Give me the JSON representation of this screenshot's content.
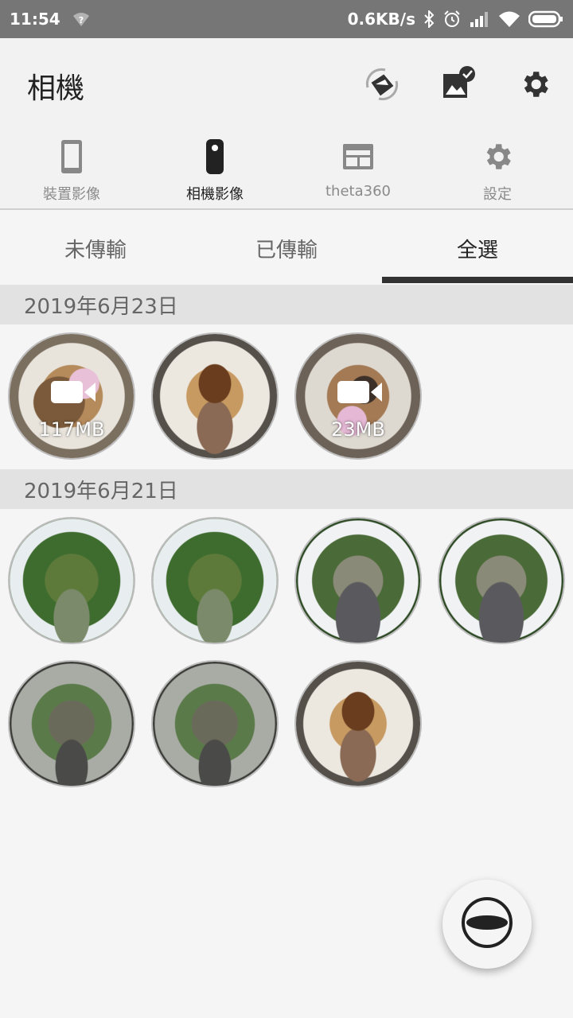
{
  "status": {
    "time": "11:54",
    "speed": "0.6KB/s"
  },
  "appbar": {
    "title": "相機",
    "icons": [
      "rotate-device-icon",
      "gallery-check-icon",
      "settings-gear-icon"
    ]
  },
  "nav": {
    "items": [
      {
        "label": "裝置影像",
        "icon": "phone-icon",
        "active": false
      },
      {
        "label": "相機影像",
        "icon": "theta-camera-icon",
        "active": true
      },
      {
        "label": "theta360",
        "icon": "web-window-icon",
        "active": false
      },
      {
        "label": "設定",
        "icon": "settings-gear-icon",
        "active": false
      }
    ]
  },
  "tabs": {
    "items": [
      {
        "label": "未傳輸",
        "active": false
      },
      {
        "label": "已傳輸",
        "active": false
      },
      {
        "label": "全選",
        "active": true
      }
    ]
  },
  "sections": [
    {
      "date": "2019年6月23日",
      "items": [
        {
          "type": "video",
          "size": "117MB",
          "scene": "indoor-a"
        },
        {
          "type": "photo",
          "size": "",
          "scene": "indoor-b"
        },
        {
          "type": "video",
          "size": "23MB",
          "scene": "indoor-c"
        }
      ]
    },
    {
      "date": "2019年6月21日",
      "items": [
        {
          "type": "photo",
          "scene": "garden"
        },
        {
          "type": "photo",
          "scene": "garden"
        },
        {
          "type": "photo",
          "scene": "plaza"
        },
        {
          "type": "photo",
          "scene": "plaza"
        },
        {
          "type": "photo",
          "scene": "greenhouse"
        },
        {
          "type": "photo",
          "scene": "greenhouse"
        },
        {
          "type": "photo",
          "scene": "indoor-b"
        }
      ]
    }
  ],
  "fab": {
    "icon": "theta-lens-icon"
  },
  "colors": {
    "statusbar": "#767676",
    "indicator": "#333333",
    "section_bg": "#e2e2e2"
  }
}
